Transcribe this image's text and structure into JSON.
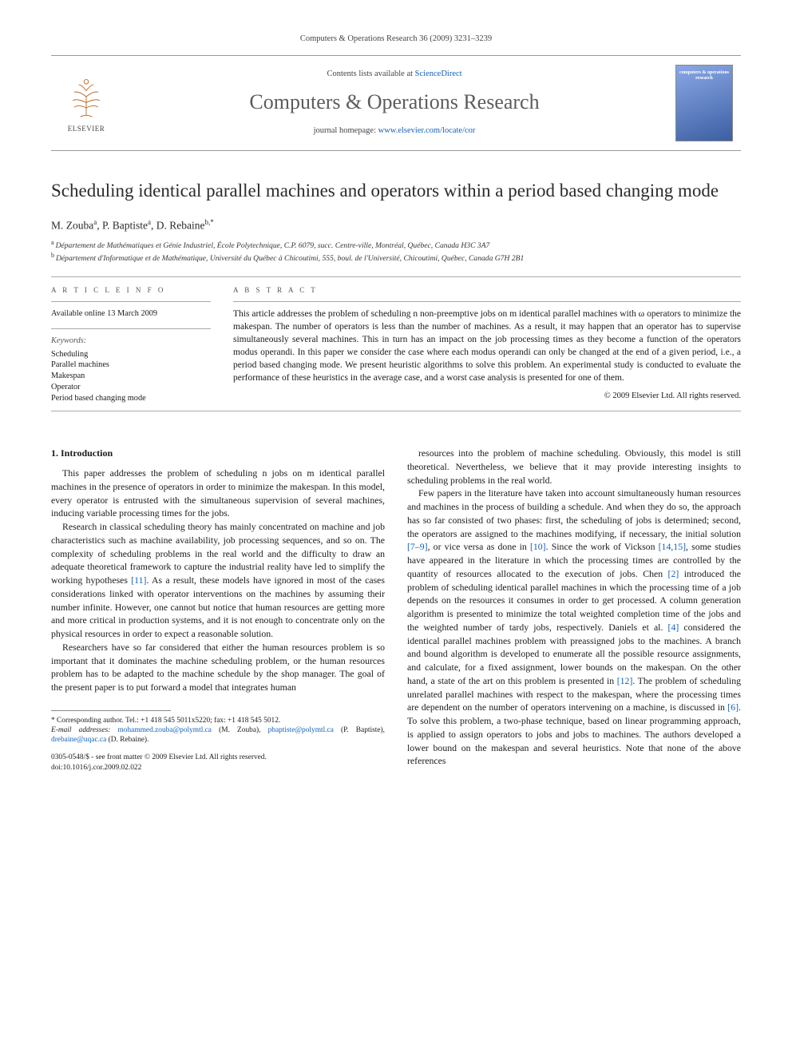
{
  "header": {
    "citation": "Computers & Operations Research 36 (2009) 3231–3239"
  },
  "masthead": {
    "publisher": "ELSEVIER",
    "contents_prefix": "Contents lists available at ",
    "contents_link": "ScienceDirect",
    "journal": "Computers & Operations Research",
    "homepage_prefix": "journal homepage: ",
    "homepage_url": "www.elsevier.com/locate/cor",
    "cover_line1": "computers & operations research"
  },
  "article": {
    "title": "Scheduling identical parallel machines and operators within a period based changing mode",
    "authors_html": "M. Zouba",
    "authors": [
      {
        "name": "M. Zouba",
        "aff": "a"
      },
      {
        "name": "P. Baptiste",
        "aff": "a"
      },
      {
        "name": "D. Rebaine",
        "aff": "b,*"
      }
    ],
    "affiliations": [
      {
        "label": "a",
        "text": "Département de Mathématiques et Génie Industriel, École Polytechnique, C.P. 6079, succ. Centre-ville, Montréal, Québec, Canada H3C 3A7"
      },
      {
        "label": "b",
        "text": "Département d'Informatique et de Mathématique, Université du Québec à Chicoutimi, 555, boul. de l'Université, Chicoutimi, Québec, Canada G7H 2B1"
      }
    ]
  },
  "info": {
    "section_head": "A R T I C L E   I N F O",
    "available": "Available online 13 March 2009",
    "keywords_head": "Keywords:",
    "keywords": [
      "Scheduling",
      "Parallel machines",
      "Makespan",
      "Operator",
      "Period based changing mode"
    ]
  },
  "abstract": {
    "head": "A B S T R A C T",
    "text": "This article addresses the problem of scheduling n non-preemptive jobs on m identical parallel machines with ω operators to minimize the makespan. The number of operators is less than the number of machines. As a result, it may happen that an operator has to supervise simultaneously several machines. This in turn has an impact on the job processing times as they become a function of the operators modus operandi. In this paper we consider the case where each modus operandi can only be changed at the end of a given period, i.e., a period based changing mode. We present heuristic algorithms to solve this problem. An experimental study is conducted to evaluate the performance of these heuristics in the average case, and a worst case analysis is presented for one of them.",
    "copyright": "© 2009 Elsevier Ltd. All rights reserved."
  },
  "body": {
    "section_num": "1.",
    "section_title": "Introduction",
    "p1": "This paper addresses the problem of scheduling n jobs on m identical parallel machines in the presence of operators in order to minimize the makespan. In this model, every operator is entrusted with the simultaneous supervision of several machines, inducing variable processing times for the jobs.",
    "p2a": "Research in classical scheduling theory has mainly concentrated on machine and job characteristics such as machine availability, job processing sequences, and so on. The complexity of scheduling problems in the real world and the difficulty to draw an adequate theoretical framework to capture the industrial reality have led to simplify the working hypotheses ",
    "p2_ref1": "[11]",
    "p2b": ". As a result, these models have ignored in most of the cases considerations linked with operator interventions on the machines by assuming their number infinite. However, one cannot but notice that human resources are getting more and more critical in production systems, and it is not enough to concentrate only on the physical resources in order to expect a reasonable solution.",
    "p3": "Researchers have so far considered that either the human resources problem is so important that it dominates the machine scheduling problem, or the human resources problem has to be adapted to the machine schedule by the shop manager. The goal of the present paper is to put forward a model that integrates human",
    "p4": "resources into the problem of machine scheduling. Obviously, this model is still theoretical. Nevertheless, we believe that it may provide interesting insights to scheduling problems in the real world.",
    "p5a": "Few papers in the literature have taken into account simultaneously human resources and machines in the process of building a schedule. And when they do so, the approach has so far consisted of two phases: first, the scheduling of jobs is determined; second, the operators are assigned to the machines modifying, if necessary, the initial solution ",
    "p5_ref1": "[7–9]",
    "p5b": ", or vice versa as done in ",
    "p5_ref2": "[10]",
    "p5c": ". Since the work of Vickson ",
    "p5_ref3": "[14,15]",
    "p5d": ", some studies have appeared in the literature in which the processing times are controlled by the quantity of resources allocated to the execution of jobs. Chen ",
    "p5_ref4": "[2]",
    "p5e": " introduced the problem of scheduling identical parallel machines in which the processing time of a job depends on the resources it consumes in order to get processed. A column generation algorithm is presented to minimize the total weighted completion time of the jobs and the weighted number of tardy jobs, respectively. Daniels et al. ",
    "p5_ref5": "[4]",
    "p5f": " considered the identical parallel machines problem with preassigned jobs to the machines. A branch and bound algorithm is developed to enumerate all the possible resource assignments, and calculate, for a fixed assignment, lower bounds on the makespan. On the other hand, a state of the art on this problem is presented in ",
    "p5_ref6": "[12]",
    "p5g": ". The problem of scheduling unrelated parallel machines with respect to the makespan, where the processing times are dependent on the number of operators intervening on a machine, is discussed in ",
    "p5_ref7": "[6]",
    "p5h": ". To solve this problem, a two-phase technique, based on linear programming approach, is applied to assign operators to jobs and jobs to machines. The authors developed a lower bound on the makespan and several heuristics. Note that none of the above references"
  },
  "footnote": {
    "corr": "* Corresponding author. Tel.: +1 418 545 5011x5220; fax: +1 418 545 5012.",
    "emails_label": "E-mail addresses: ",
    "email1": "mohammed.zouba@polymtl.ca",
    "email1_who": " (M. Zouba), ",
    "email2": "pbaptiste@polymtl.ca",
    "email2_who": " (P. Baptiste), ",
    "email3": "drebaine@uqac.ca",
    "email3_who": " (D. Rebaine)."
  },
  "doi": {
    "line1": "0305-0548/$ - see front matter © 2009 Elsevier Ltd. All rights reserved.",
    "line2": "doi:10.1016/j.cor.2009.02.022"
  }
}
